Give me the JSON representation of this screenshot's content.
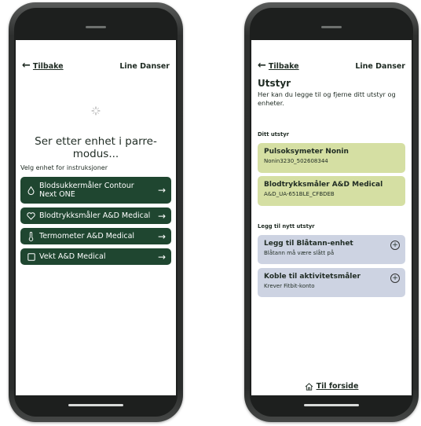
{
  "left": {
    "back_label": "Tilbake",
    "user_name": "Line Danser",
    "status_text": "Ser etter enhet i parre-modus...",
    "instructions_label": "Velg enhet for instruksjoner",
    "devices": [
      {
        "line1": "Blodsukkermåler Contour",
        "line2": "Next ONE",
        "icon": "drop-icon"
      },
      {
        "line1": "Blodtrykksmåler A&D Medical",
        "line2": "",
        "icon": "heart-icon"
      },
      {
        "line1": "Termometer A&D Medical",
        "line2": "",
        "icon": "thermometer-icon"
      },
      {
        "line1": "Vekt A&D Medical",
        "line2": "",
        "icon": "scale-icon"
      }
    ],
    "arrow": "→"
  },
  "right": {
    "back_label": "Tilbake",
    "user_name": "Line Danser",
    "title": "Utstyr",
    "description": "Her kan du legge til og fjerne ditt utstyr og enheter.",
    "owned_label": "Ditt utstyr",
    "owned": [
      {
        "title": "Pulsoksymeter Nonin",
        "subtitle": "Nonin3230_502608344"
      },
      {
        "title": "Blodtrykksmåler A&D Medical",
        "subtitle": "A&D_UA-651BLE_CFBDEB"
      }
    ],
    "new_label": "Legg til nytt utstyr",
    "add_options": [
      {
        "title": "Legg til Blåtann-enhet",
        "subtitle": "Blåtann må være slått på"
      },
      {
        "title": "Koble til aktivitetsmåler",
        "subtitle": "Krever Fitbit-konto"
      }
    ],
    "home_label": "Til forside"
  },
  "colors": {
    "dark_green": "#1f4630",
    "owned_bg": "#d5dfa3",
    "add_bg": "#cdd3e2"
  }
}
